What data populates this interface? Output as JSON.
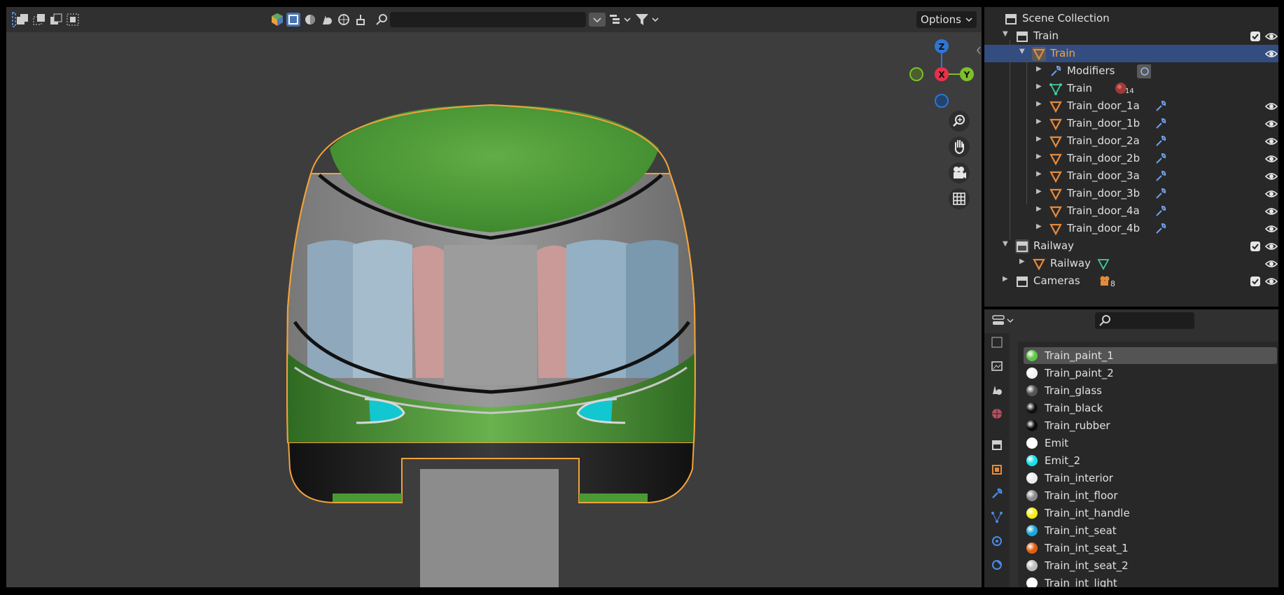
{
  "viewport": {
    "header": {
      "search_placeholder": "",
      "options_label": "Options"
    },
    "navigation_gizmo": {
      "axes": [
        "Z",
        "X",
        "Y"
      ]
    }
  },
  "outliner": {
    "root_label": "Scene Collection",
    "rows": [
      {
        "label": "Train",
        "type": "collection",
        "expanded": true,
        "checked": true,
        "visible": true
      },
      {
        "label": "Train",
        "type": "object",
        "expanded": true,
        "active": true,
        "visible": true
      },
      {
        "label": "Modifiers",
        "type": "modifiers"
      },
      {
        "label": "Train",
        "type": "mesh",
        "badge": "14"
      },
      {
        "label": "Train_door_1a",
        "type": "object",
        "visible": true
      },
      {
        "label": "Train_door_1b",
        "type": "object",
        "visible": true
      },
      {
        "label": "Train_door_2a",
        "type": "object",
        "visible": true
      },
      {
        "label": "Train_door_2b",
        "type": "object",
        "visible": true
      },
      {
        "label": "Train_door_3a",
        "type": "object",
        "visible": true
      },
      {
        "label": "Train_door_3b",
        "type": "object",
        "visible": true
      },
      {
        "label": "Train_door_4a",
        "type": "object",
        "visible": true
      },
      {
        "label": "Train_door_4b",
        "type": "object",
        "visible": true
      },
      {
        "label": "Railway",
        "type": "collection",
        "expanded": true,
        "checked": true,
        "visible": true
      },
      {
        "label": "Railway",
        "type": "object",
        "visible": true
      },
      {
        "label": "Cameras",
        "type": "collection",
        "badge": "8",
        "checked": true,
        "visible": true
      }
    ]
  },
  "properties": {
    "search_placeholder": "",
    "materials": [
      {
        "name": "Train_paint_1",
        "color": "#5fc646",
        "active": true
      },
      {
        "name": "Train_paint_2",
        "color": "#f2f2f2"
      },
      {
        "name": "Train_glass",
        "color": "#555555"
      },
      {
        "name": "Train_black",
        "color": "#111111"
      },
      {
        "name": "Train_rubber",
        "color": "#0a0a0a"
      },
      {
        "name": "Emit",
        "color": "#ffffff"
      },
      {
        "name": "Emit_2",
        "color": "#16e0e8"
      },
      {
        "name": "Train_interior",
        "color": "#ececec"
      },
      {
        "name": "Train_int_floor",
        "color": "#8a8a8a"
      },
      {
        "name": "Train_int_handle",
        "color": "#f5ee1a"
      },
      {
        "name": "Train_int_seat",
        "color": "#1ba6d8"
      },
      {
        "name": "Train_int_seat_1",
        "color": "#e0600f"
      },
      {
        "name": "Train_int_seat_2",
        "color": "#bdbdbd"
      },
      {
        "name": "Train_int_light",
        "color": "#ffffff"
      }
    ]
  },
  "colors": {
    "accent": "#4772b3",
    "selection_outline": "#f2a33a",
    "active_row": "#334d80"
  }
}
